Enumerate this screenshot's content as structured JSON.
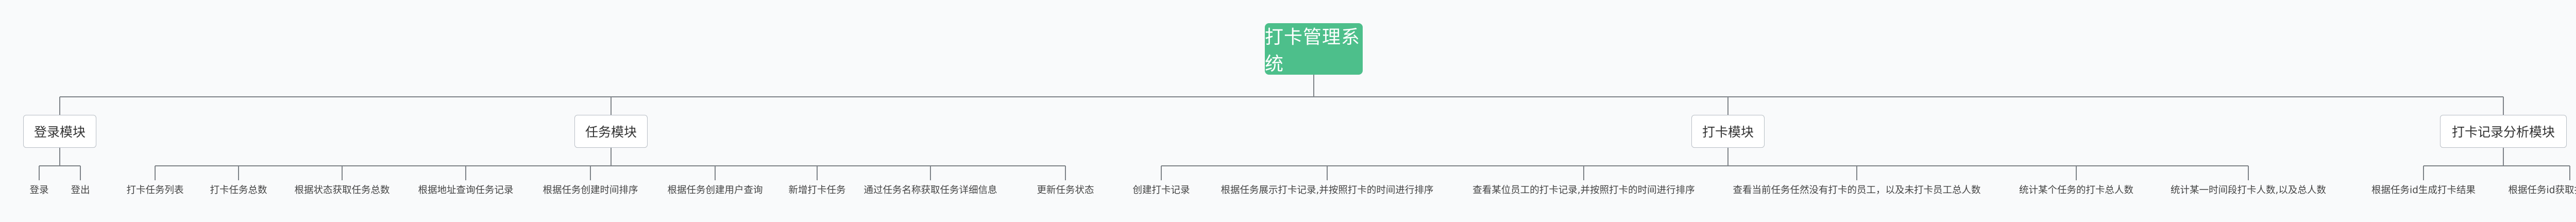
{
  "root": {
    "label": "打卡管理系统"
  },
  "colors": {
    "root_bg": "#4dbf8b",
    "line": "#7d8287",
    "module_border": "#b7bdc4",
    "background": "#f9fafb"
  },
  "modules": [
    {
      "label": "登录模块",
      "children": [
        "登录",
        "登出"
      ]
    },
    {
      "label": "任务模块",
      "children": [
        "打卡任务列表",
        "打卡任务总数",
        "根据状态获取任务总数",
        "根据地址查询任务记录",
        "根据任务创建时间排序",
        "根据任务创建用户查询",
        "新增打卡任务",
        "通过任务名称获取任务详细信息",
        "更新任务状态"
      ]
    },
    {
      "label": "打卡模块",
      "children": [
        "创建打卡记录",
        "根据任务展示打卡记录,并按照打卡的时间进行排序",
        "查看某位员工的打卡记录,并按照打卡的时间进行排序",
        "查看当前任务任然没有打卡的员工，以及未打卡员工总人数",
        "统计某个任务的打卡总人数",
        "统计某一时间段打卡人数,以及总人数"
      ]
    },
    {
      "label": "打卡记录分析模块",
      "children": [
        "根据任务id生成打卡结果",
        "根据任务id获取打卡统计信息"
      ]
    }
  ]
}
